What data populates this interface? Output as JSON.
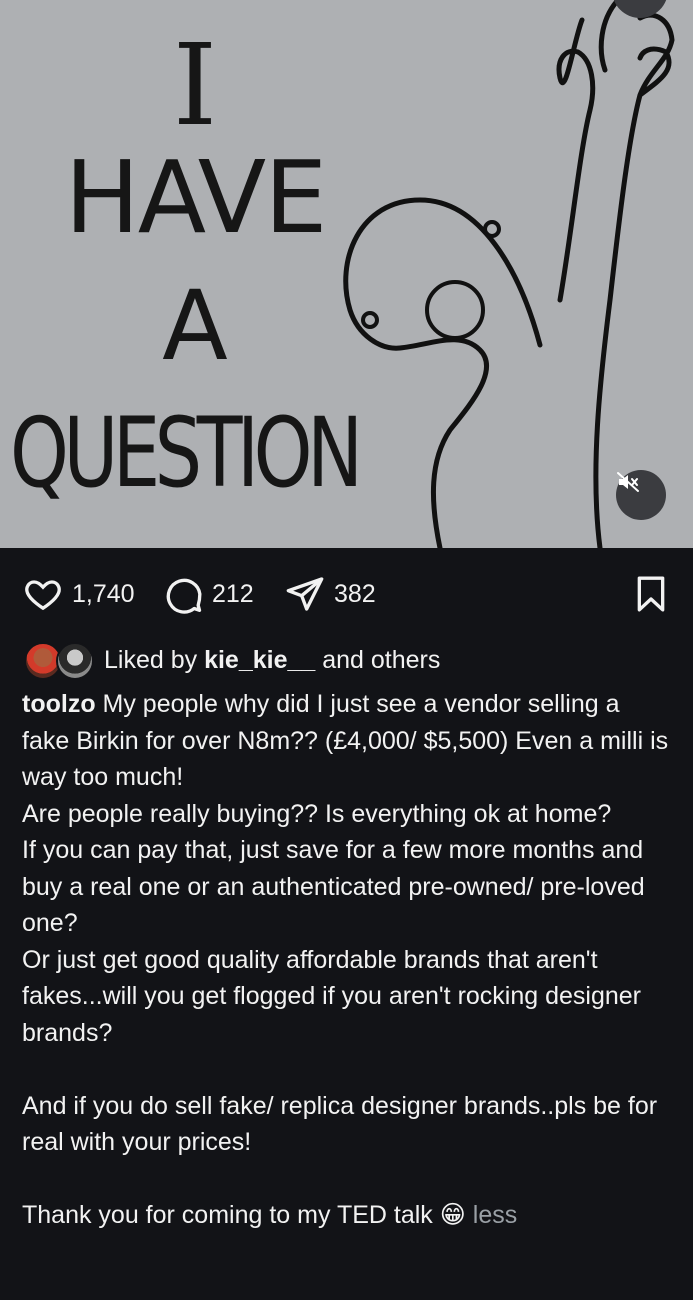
{
  "post_image": {
    "headline_lines": [
      "I",
      "HAVE",
      "A",
      "QUESTION"
    ],
    "mute_icon": "speaker-muted-icon"
  },
  "actions": {
    "likes": "1,740",
    "comments": "212",
    "shares": "382"
  },
  "liked_by": {
    "prefix": "Liked by ",
    "user": "kie_kie__",
    "suffix": " and others"
  },
  "caption": {
    "username": "toolzo",
    "text": " My people why did I just see a vendor selling a fake Birkin for over N8m?? (£4,000/ $5,500) Even a milli is way too much!\nAre people really buying?? Is everything ok at home?\nIf you can pay that, just save for a few more months and buy a real one or an authenticated pre-owned/ pre-loved one?\nOr just get good quality affordable brands that aren't fakes...will you get flogged if you aren't rocking designer brands?\n\nAnd if you do sell fake/ replica designer brands..pls be for real with your prices!\n\nThank you for coming to my TED talk 😁",
    "less_label": "less"
  }
}
